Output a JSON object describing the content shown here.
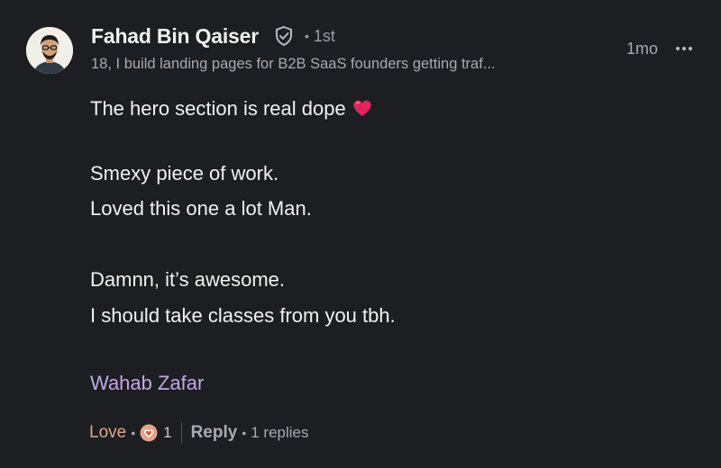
{
  "comment": {
    "author": {
      "name": "Fahad Bin Qaiser",
      "degree": "1st",
      "headline": "18, I build landing pages for B2B SaaS founders getting traf..."
    },
    "timestamp": "1mo",
    "body": {
      "line1": "The hero section is real dope",
      "line2": "Smexy piece of work.",
      "line3": "Loved this one a lot Man.",
      "line4": "Damnn, it’s awesome.",
      "line5": "I should take classes from you tbh."
    },
    "mention": "Wahab Zafar",
    "actions": {
      "love_label": "Love",
      "reaction_count": "1",
      "reply_label": "Reply",
      "replies_count": "1 replies"
    }
  },
  "icons": {
    "verified": "shield-check-icon",
    "more": "more-horizontal-icon",
    "heart_emoji": "red-heart-icon",
    "reaction": "heart-reaction-icon"
  },
  "colors": {
    "background": "#1c1e21",
    "mention": "#c4a7e7",
    "love": "#e3a58a",
    "heart": "#e0245e"
  }
}
